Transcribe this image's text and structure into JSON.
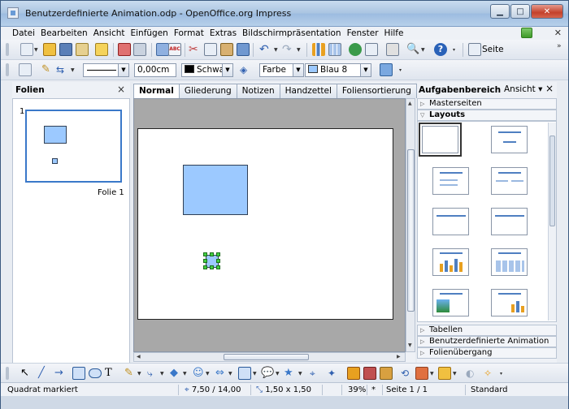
{
  "window": {
    "title": "Benutzerdefinierte Animation.odp - OpenOffice.org Impress"
  },
  "menu": [
    "Datei",
    "Bearbeiten",
    "Ansicht",
    "Einfügen",
    "Format",
    "Extras",
    "Bildschirmpräsentation",
    "Fenster",
    "Hilfe"
  ],
  "toolbar": {
    "slide_label": "Seite"
  },
  "line_toolbar": {
    "width": "0,00cm",
    "line_color": "Schwarz",
    "fill_type": "Farbe",
    "fill_color": "Blau 8"
  },
  "slides_panel": {
    "title": "Folien",
    "close": "×",
    "slide_number": "1",
    "slide_name": "Folie 1"
  },
  "editor": {
    "tabs": [
      "Normal",
      "Gliederung",
      "Notizen",
      "Handzettel",
      "Foliensortierung"
    ],
    "active_tab": "Normal"
  },
  "task_pane": {
    "title": "Aufgabenbereich",
    "view_menu": "Ansicht",
    "close": "×",
    "sections": {
      "master": "Masterseiten",
      "layouts": "Layouts",
      "tables": "Tabellen",
      "animation": "Benutzerdefinierte Animation",
      "transition": "Folienübergang"
    }
  },
  "status": {
    "message": "Quadrat markiert",
    "position": "7,50 / 14,00",
    "size": "1,50 x 1,50",
    "zoom": "39%",
    "modified": "*",
    "page": "Seite 1 / 1",
    "layout": "Standard"
  },
  "colors": {
    "shape_fill": "#9cc9ff",
    "selection_handle": "#41d041",
    "tab_active": "#ffffff"
  }
}
